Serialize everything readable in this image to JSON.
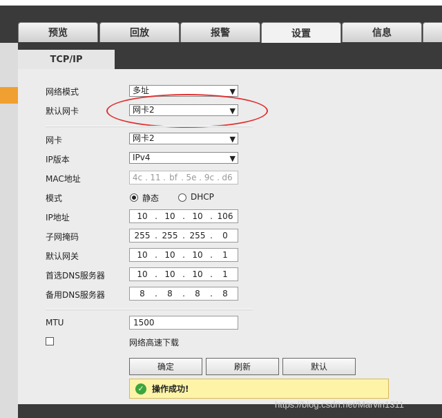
{
  "tabs": [
    {
      "label": "预览"
    },
    {
      "label": "回放"
    },
    {
      "label": "报警"
    },
    {
      "label": "设置",
      "active": true
    },
    {
      "label": "信息"
    }
  ],
  "subtab": {
    "label": "TCP/IP"
  },
  "form": {
    "network_mode": {
      "label": "网络模式",
      "value": "多址"
    },
    "default_nic": {
      "label": "默认网卡",
      "value": "网卡2"
    },
    "nic": {
      "label": "网卡",
      "value": "网卡2"
    },
    "ip_version": {
      "label": "IP版本",
      "value": "IPv4"
    },
    "mac": {
      "label": "MAC地址",
      "octets": [
        "4c",
        "11",
        "bf",
        "5e",
        "9c",
        "d6"
      ]
    },
    "mode": {
      "label": "模式",
      "static_label": "静态",
      "dhcp_label": "DHCP",
      "selected": "静态"
    },
    "ip": {
      "label": "IP地址",
      "octets": [
        "10",
        "10",
        "10",
        "106"
      ]
    },
    "subnet": {
      "label": "子网掩码",
      "octets": [
        "255",
        "255",
        "255",
        "0"
      ]
    },
    "gateway": {
      "label": "默认网关",
      "octets": [
        "10",
        "10",
        "10",
        "1"
      ]
    },
    "dns1": {
      "label": "首选DNS服务器",
      "octets": [
        "10",
        "10",
        "10",
        "1"
      ]
    },
    "dns2": {
      "label": "备用DNS服务器",
      "octets": [
        "8",
        "8",
        "8",
        "8"
      ]
    },
    "mtu": {
      "label": "MTU",
      "value": "1500"
    },
    "highspeed": {
      "label": "网络高速下载",
      "checked": false
    }
  },
  "buttons": {
    "confirm": "确定",
    "refresh": "刷新",
    "default": "默认"
  },
  "status": {
    "message": "操作成功!",
    "icon": "check-icon"
  },
  "watermark": "https://blog.csdn.net/Marvin1311",
  "colors": {
    "highlight_ellipse": "#e03030",
    "success_bg": "#fdf4a8",
    "accent": "#f0a030"
  }
}
